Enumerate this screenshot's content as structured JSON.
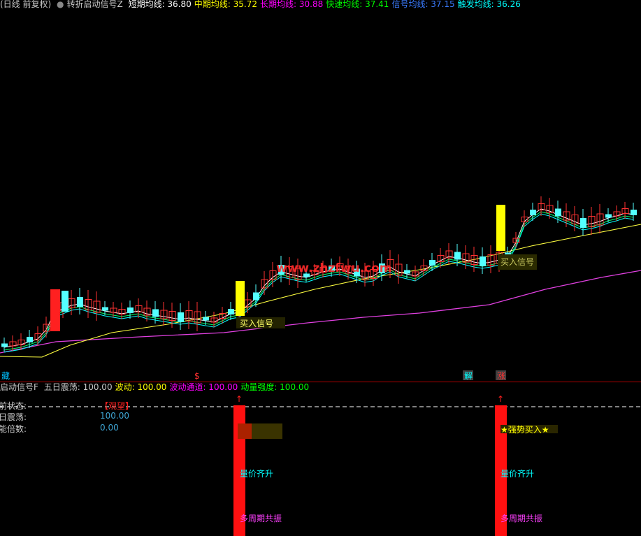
{
  "header": {
    "period": "(日线 前复权)",
    "indicator": "转折启动信号Z",
    "items": [
      {
        "label": "短期均线:",
        "value": "36.80",
        "color": "#ffffff"
      },
      {
        "label": "中期均线:",
        "value": "35.72",
        "color": "#ffff00"
      },
      {
        "label": "长期均线:",
        "value": "30.88",
        "color": "#ff00ff"
      },
      {
        "label": "快速均线:",
        "value": "37.41",
        "color": "#00ff00"
      },
      {
        "label": "信号均线:",
        "value": "37.15",
        "color": "#3a7bff"
      },
      {
        "label": "触发均线:",
        "value": "36.26",
        "color": "#00ffff"
      }
    ]
  },
  "main_chart": {
    "signal_label_1": "买入信号",
    "signal_label_2": "买入信号",
    "watermark": "www.zhzfwu.com",
    "bottom_markers": [
      {
        "text": "藏",
        "color": "#00c0ff"
      },
      {
        "text": "$",
        "color": "#ff3030"
      },
      {
        "text": "解",
        "color": "#00ffff"
      },
      {
        "text": "涨",
        "color": "#ff3030"
      }
    ],
    "colors": {
      "up": "#ff3232",
      "down": "#54ffff",
      "signal_bar": "#ffff00",
      "bull_bar": "#ff2020"
    }
  },
  "sub_header": {
    "name": "启动信号F",
    "items": [
      {
        "label": "五日震荡:",
        "value": "100.00",
        "color": "#c8c8c8"
      },
      {
        "label": "波动:",
        "value": "100.00",
        "color": "#ffff00"
      },
      {
        "label": "波动通道:",
        "value": "100.00",
        "color": "#ff00ff"
      },
      {
        "label": "动量强度:",
        "value": "100.00",
        "color": "#00ff00"
      }
    ]
  },
  "sub_chart": {
    "rows": [
      {
        "label": "前状态:",
        "value": "【观望】",
        "value_color": "#ff2020"
      },
      {
        "label": "日震荡:",
        "value": "100.00",
        "value_color": "#3fa7d6"
      },
      {
        "label": "能倍数:",
        "value": "0.00",
        "value_color": "#3fa7d6"
      }
    ],
    "signal_text_1": "量价齐升",
    "signal_text_2": "多周期共振",
    "signal_text_3": "★强势买入★"
  }
}
